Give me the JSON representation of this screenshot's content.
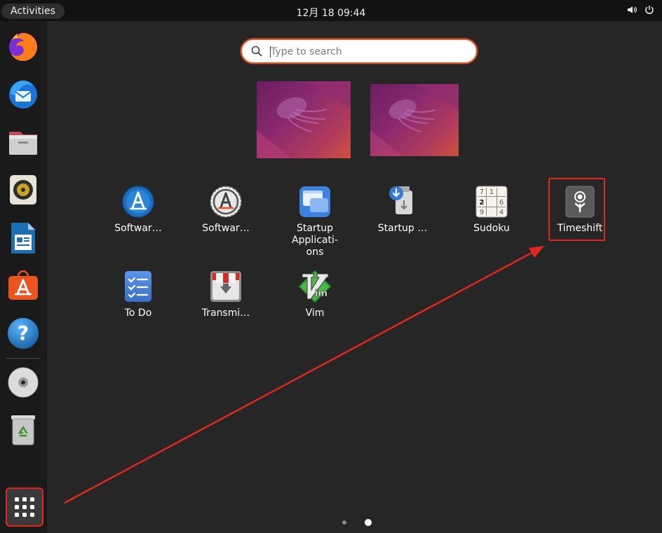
{
  "topbar": {
    "activities": "Activities",
    "clock": "12月 18  09:44",
    "icons": [
      "volume-icon",
      "power-icon"
    ]
  },
  "dock": {
    "items": [
      {
        "name": "firefox-icon"
      },
      {
        "name": "thunderbird-icon"
      },
      {
        "name": "files-icon"
      },
      {
        "name": "rhythmbox-icon"
      },
      {
        "name": "libreoffice-writer-icon"
      },
      {
        "name": "ubuntu-software-icon"
      },
      {
        "name": "help-icon"
      },
      {
        "name": "disc-icon"
      },
      {
        "name": "trash-icon"
      }
    ],
    "show_apps": "show-applications-icon"
  },
  "search": {
    "placeholder": "Type to search",
    "value": ""
  },
  "workspaces": [
    "workspace-1",
    "workspace-2"
  ],
  "apps": [
    {
      "label": "Softwar…",
      "icon": "software-updater-icon"
    },
    {
      "label": "Softwar…",
      "icon": "software-properties-icon"
    },
    {
      "label": "Startup\nApplicati-\nons",
      "icon": "startup-applications-icon"
    },
    {
      "label": "Startup …",
      "icon": "startup-disk-creator-icon"
    },
    {
      "label": "Sudoku",
      "icon": "sudoku-icon"
    },
    {
      "label": "Timeshift",
      "icon": "timeshift-icon"
    },
    {
      "label": "To Do",
      "icon": "todo-icon"
    },
    {
      "label": "Transmi…",
      "icon": "transmission-icon"
    },
    {
      "label": "Vim",
      "icon": "vim-icon"
    }
  ],
  "sudoku_digits": [
    "7",
    "1",
    "2",
    "6",
    "9",
    "4"
  ],
  "pagination": {
    "pages": 2,
    "current": 2
  },
  "colors": {
    "accent": "#e95420",
    "annotation": "#e0281c",
    "background": "#262626"
  }
}
